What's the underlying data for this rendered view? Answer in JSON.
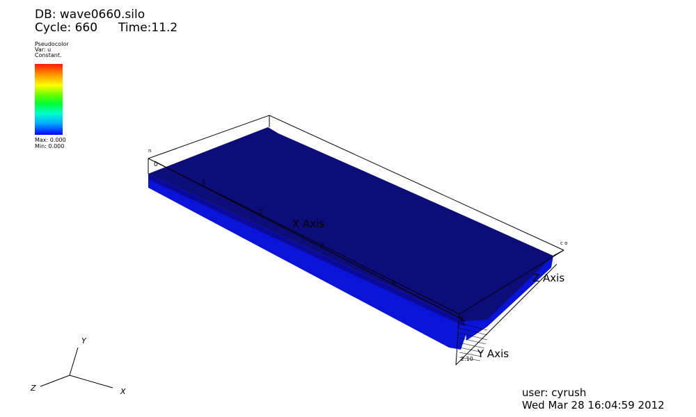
{
  "header": {
    "db": "DB: wave0660.silo",
    "cycle": "Cycle: 660",
    "time": "Time:11.2"
  },
  "legend": {
    "plot_type": "Pseudocolor",
    "var": "Var: u",
    "mode": "Constant.",
    "max": "Max:  0.000",
    "min": "Min:  0.000",
    "colormap": [
      "#ff1a00",
      "#ffff00",
      "#00ff33",
      "#00aaff",
      "#0000ff"
    ]
  },
  "axes": {
    "x_title": "X Axis",
    "y_title": "Y Axis",
    "z_title": "Z Axis",
    "x_ticks": [
      "0",
      "1",
      "2",
      "3",
      "4",
      "5"
    ],
    "corner_label_left": "n",
    "corner_label_right": "c o",
    "y_tick_cluster": "2.10"
  },
  "triad": {
    "x": "X",
    "y": "Y",
    "z": "Z"
  },
  "footer": {
    "user": "user: cyrush",
    "date": "Wed Mar 28 16:04:59 2012"
  },
  "colors": {
    "surface_top": "#0d0d7a",
    "surface_front": "#0a14d8",
    "background": "#ffffff"
  }
}
